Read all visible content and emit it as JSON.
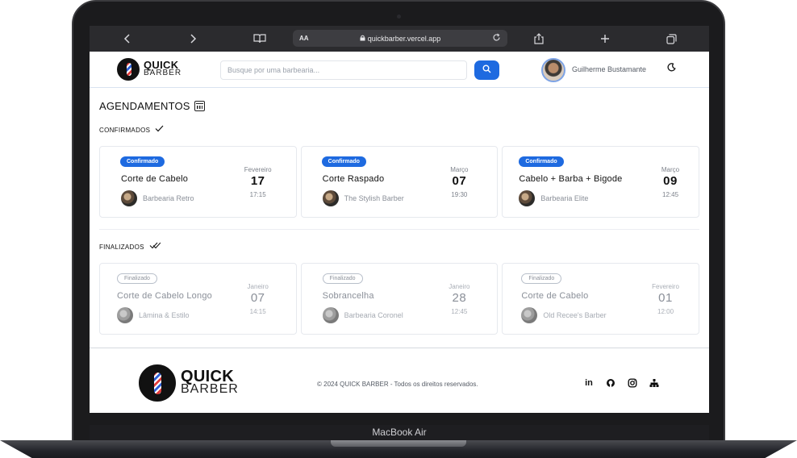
{
  "device": {
    "label": "MacBook Air"
  },
  "browser": {
    "aa_label": "AA",
    "url": "quickbarber.vercel.app",
    "icons": [
      "back-icon",
      "forward-icon",
      "book-icon",
      "lock-icon",
      "reload-icon",
      "share-icon",
      "plus-icon",
      "tabs-icon"
    ]
  },
  "header": {
    "logo_top": "QUICK",
    "logo_bottom": "BARBER",
    "search_placeholder": "Busque por uma barbearia...",
    "user_name": "Guilherme Bustamante"
  },
  "main": {
    "title": "AGENDAMENTOS",
    "confirmed_label": "CONFIRMADOS",
    "finished_label": "FINALIZADOS",
    "confirmed": [
      {
        "status": "Confirmado",
        "service": "Corte de Cabelo",
        "shop": "Barbearia Retro",
        "month": "Fevereiro",
        "day": "17",
        "time": "17:15"
      },
      {
        "status": "Confirmado",
        "service": "Corte Raspado",
        "shop": "The Stylish Barber",
        "month": "Março",
        "day": "07",
        "time": "19:30"
      },
      {
        "status": "Confirmado",
        "service": "Cabelo + Barba + Bigode",
        "shop": "Barbearia Elite",
        "month": "Março",
        "day": "09",
        "time": "12:45"
      }
    ],
    "finished": [
      {
        "status": "Finalizado",
        "service": "Corte de Cabelo Longo",
        "shop": "Lâmina & Estilo",
        "month": "Janeiro",
        "day": "07",
        "time": "14:15"
      },
      {
        "status": "Finalizado",
        "service": "Sobrancelha",
        "shop": "Barbearia Coronel",
        "month": "Janeiro",
        "day": "28",
        "time": "12:45"
      },
      {
        "status": "Finalizado",
        "service": "Corte de Cabelo",
        "shop": "Old Recee's Barber",
        "month": "Fevereiro",
        "day": "01",
        "time": "12:00"
      }
    ]
  },
  "footer": {
    "logo_top": "QUICK",
    "logo_bottom": "BARBER",
    "copyright": "© 2024 QUICK BARBER - Todos os direitos reservados.",
    "social_icons": [
      "linkedin-icon",
      "github-icon",
      "instagram-icon",
      "sitemap-icon"
    ]
  },
  "colors": {
    "primary": "#1e6ae0",
    "text": "#111111",
    "muted": "#8a8f98"
  }
}
